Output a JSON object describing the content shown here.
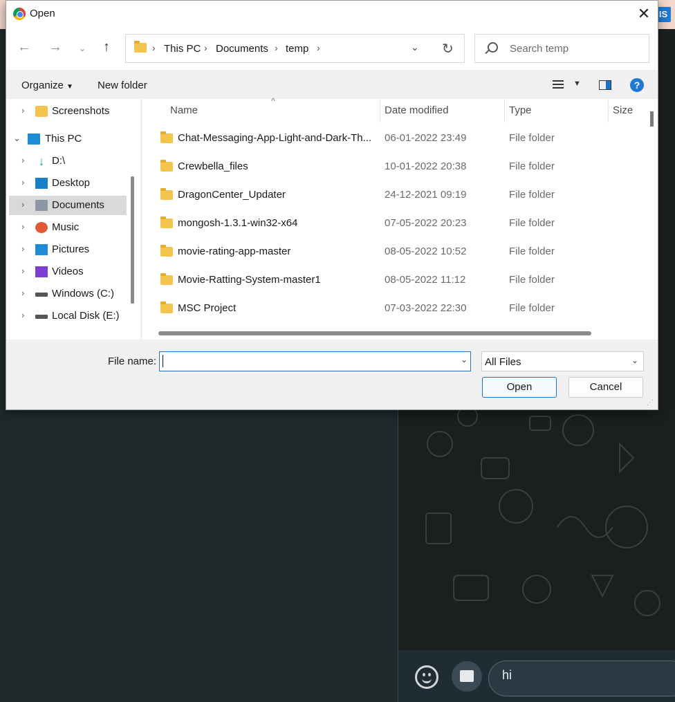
{
  "dialog": {
    "title": "Open",
    "close_icon": "close-icon"
  },
  "nav": {
    "back_icon": "arrow-left-icon",
    "forward_icon": "arrow-right-icon",
    "recent_icon": "chevron-down-icon",
    "up_icon": "arrow-up-icon",
    "breadcrumbs": [
      "This PC",
      "Documents",
      "temp"
    ],
    "refresh_icon": "refresh-icon",
    "search_placeholder": "Search temp"
  },
  "toolbar": {
    "organize_label": "Organize",
    "new_folder_label": "New folder",
    "help_label": "?"
  },
  "sidebar": {
    "items": [
      {
        "label": "Screenshots",
        "icon": "folder-icon"
      },
      {
        "label": "This PC",
        "icon": "computer-icon"
      },
      {
        "label": "D:\\",
        "icon": "download-icon"
      },
      {
        "label": "Desktop",
        "icon": "desktop-icon"
      },
      {
        "label": "Documents",
        "icon": "documents-icon",
        "selected": true
      },
      {
        "label": "Music",
        "icon": "music-icon"
      },
      {
        "label": "Pictures",
        "icon": "pictures-icon"
      },
      {
        "label": "Videos",
        "icon": "videos-icon"
      },
      {
        "label": "Windows (C:)",
        "icon": "drive-icon"
      },
      {
        "label": "Local Disk (E:)",
        "icon": "drive-icon"
      }
    ]
  },
  "columns": {
    "name": "Name",
    "date": "Date modified",
    "type": "Type",
    "size": "Size"
  },
  "files": [
    {
      "name": "Chat-Messaging-App-Light-and-Dark-Th...",
      "date": "06-01-2022 23:49",
      "type": "File folder"
    },
    {
      "name": "Crewbella_files",
      "date": "10-01-2022 20:38",
      "type": "File folder"
    },
    {
      "name": "DragonCenter_Updater",
      "date": "24-12-2021 09:19",
      "type": "File folder"
    },
    {
      "name": "mongosh-1.3.1-win32-x64",
      "date": "07-05-2022 20:23",
      "type": "File folder"
    },
    {
      "name": "movie-rating-app-master",
      "date": "08-05-2022 10:52",
      "type": "File folder"
    },
    {
      "name": "Movie-Ratting-System-master1",
      "date": "08-05-2022 11:12",
      "type": "File folder"
    },
    {
      "name": "MSC Project",
      "date": "07-03-2022 22:30",
      "type": "File folder"
    }
  ],
  "footer": {
    "file_name_label": "File name:",
    "file_name_value": "",
    "filter_value": "All Files",
    "open_label": "Open",
    "cancel_label": "Cancel"
  },
  "background": {
    "badge_text": "IS",
    "message_text": "hi"
  }
}
